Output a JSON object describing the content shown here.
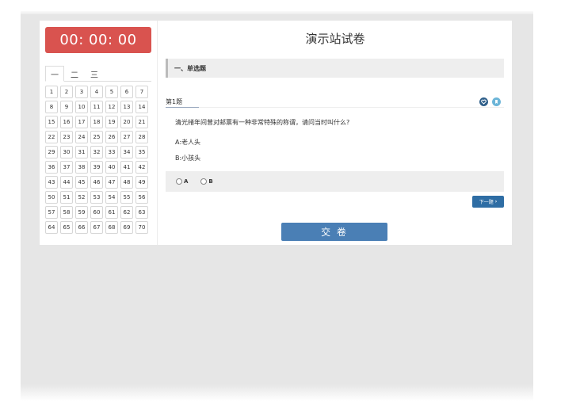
{
  "timer": "00: 00: 00",
  "exam_title": "演示站试卷",
  "tabs": [
    "一",
    "二",
    "三"
  ],
  "question_numbers": [
    "1",
    "2",
    "3",
    "4",
    "5",
    "6",
    "7",
    "8",
    "9",
    "10",
    "11",
    "12",
    "13",
    "14",
    "15",
    "16",
    "17",
    "18",
    "19",
    "20",
    "21",
    "22",
    "23",
    "24",
    "25",
    "26",
    "27",
    "28",
    "29",
    "30",
    "31",
    "32",
    "33",
    "34",
    "35",
    "36",
    "37",
    "38",
    "39",
    "40",
    "41",
    "42",
    "43",
    "44",
    "45",
    "46",
    "47",
    "48",
    "49",
    "50",
    "51",
    "52",
    "53",
    "54",
    "55",
    "56",
    "57",
    "58",
    "59",
    "60",
    "61",
    "62",
    "63",
    "64",
    "65",
    "66",
    "67",
    "68",
    "69",
    "70"
  ],
  "section_title": "一、单选题",
  "question": {
    "number_label": "第1题",
    "text": "清光绪年间曾对邮票有一种非常特殊的称谓，请问当时叫什么?",
    "options": [
      {
        "label": "A:老人头"
      },
      {
        "label": "B:小孩头"
      }
    ],
    "answer_choices": [
      "A",
      "B"
    ]
  },
  "icons": {
    "favorite": "heart-icon",
    "bookmark": "bookmark-icon",
    "next": "chevron-right-icon"
  },
  "next_button": "下一题",
  "submit_button": "交 卷",
  "colors": {
    "timer_bg": "#d9534f",
    "primary": "#2e6da4",
    "submit": "#4a7fb5",
    "section_bg": "#eeeeee"
  }
}
